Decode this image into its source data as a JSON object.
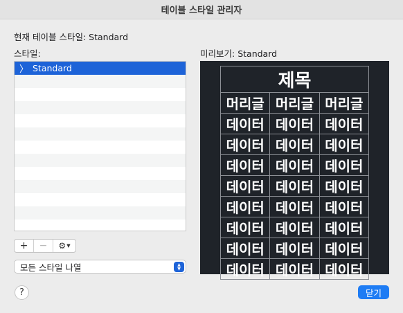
{
  "window": {
    "title": "테이블 스타일 관리자"
  },
  "current_style": {
    "label": "현재 테이블 스타일:",
    "value": "Standard"
  },
  "styles": {
    "label": "스타일:",
    "items": [
      {
        "name": "Standard",
        "selected": true
      },
      {
        "name": ""
      },
      {
        "name": ""
      },
      {
        "name": ""
      },
      {
        "name": ""
      },
      {
        "name": ""
      },
      {
        "name": ""
      },
      {
        "name": ""
      },
      {
        "name": ""
      },
      {
        "name": ""
      },
      {
        "name": ""
      },
      {
        "name": ""
      },
      {
        "name": ""
      }
    ]
  },
  "toolbar": {
    "add": "+",
    "remove": "−",
    "actions_icon": "gear-icon"
  },
  "filter": {
    "value": "모든 스타일 나열"
  },
  "preview": {
    "label_prefix": "미리보기:",
    "style_name": "Standard",
    "title": "제목",
    "header": [
      "머리글",
      "머리글",
      "머리글"
    ],
    "rows": [
      [
        "데이터",
        "데이터",
        "데이터"
      ],
      [
        "데이터",
        "데이터",
        "데이터"
      ],
      [
        "데이터",
        "데이터",
        "데이터"
      ],
      [
        "데이터",
        "데이터",
        "데이터"
      ],
      [
        "데이터",
        "데이터",
        "데이터"
      ],
      [
        "데이터",
        "데이터",
        "데이터"
      ],
      [
        "데이터",
        "데이터",
        "데이터"
      ],
      [
        "데이터",
        "데이터",
        "데이터"
      ]
    ]
  },
  "help": {
    "label": "?"
  },
  "close": {
    "label": "닫기"
  },
  "colors": {
    "accent": "#1e7cf4",
    "selection": "#1d63d8",
    "preview_bg": "#1f2329"
  }
}
